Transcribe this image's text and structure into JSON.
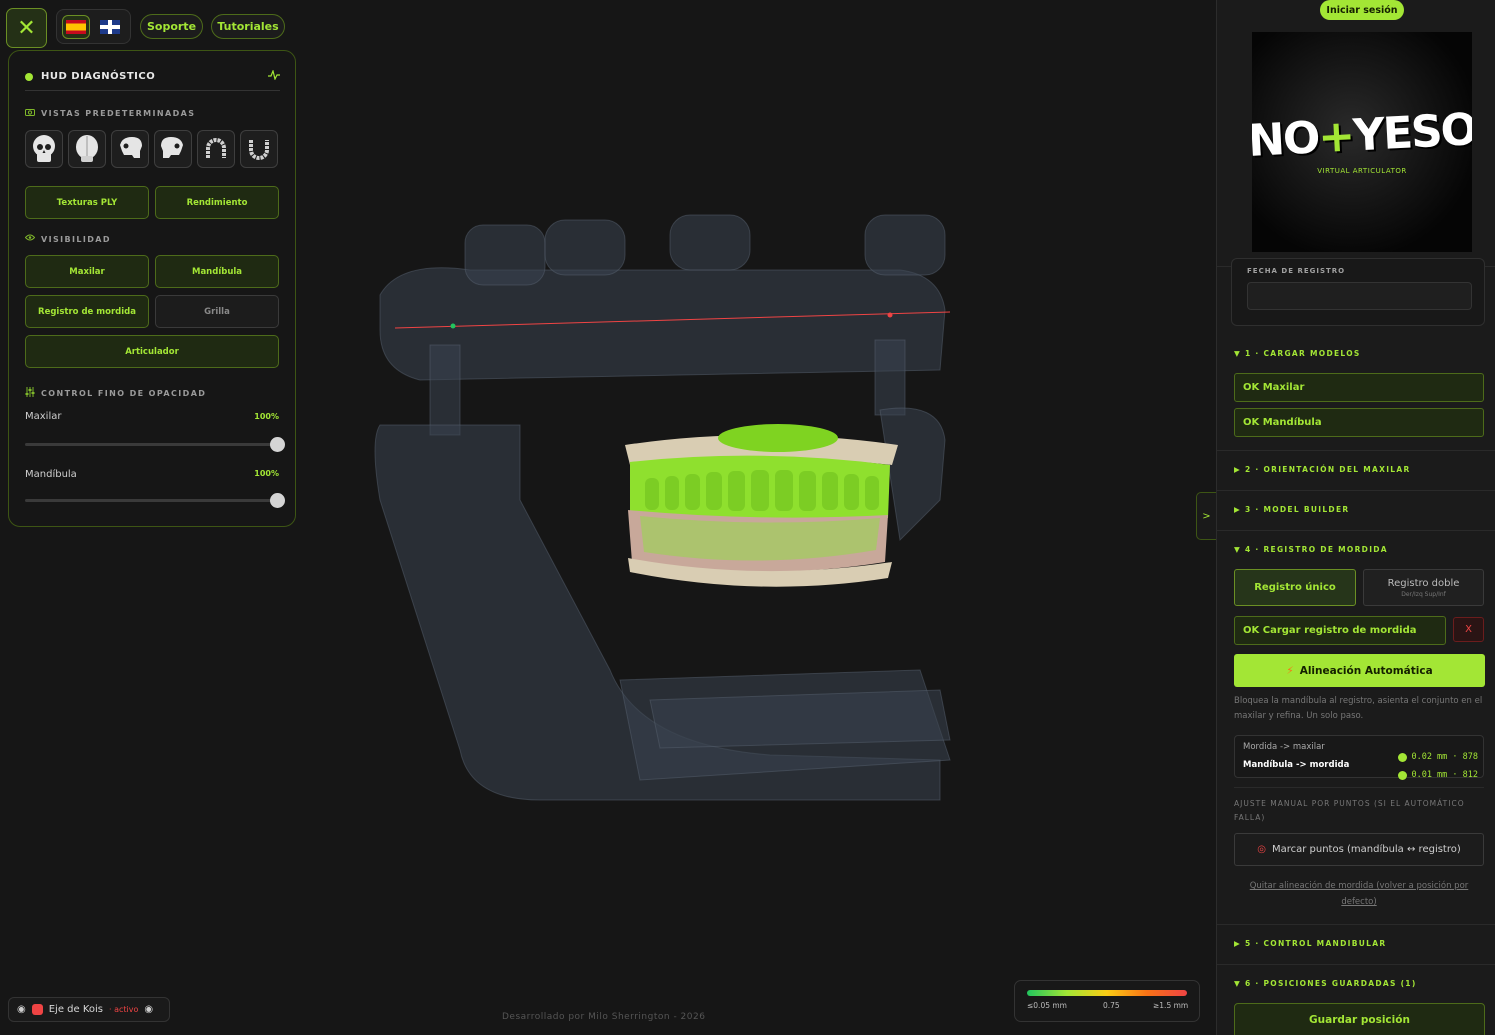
{
  "toolbar": {
    "close_symbol": "✕",
    "support": "Soporte",
    "tutorials": "Tutoriales"
  },
  "hud": {
    "title": "HUD DIAGNÓSTICO",
    "views_title": "VISTAS PREDETERMINADAS",
    "btn_textures": "Texturas PLY",
    "btn_performance": "Rendimiento",
    "visibility_title": "VISIBILIDAD",
    "vis": {
      "maxilar": "Maxilar",
      "mandibula": "Mandíbula",
      "registro": "Registro de mordida",
      "grilla": "Grilla",
      "articulador": "Articulador"
    },
    "opacity_title": "CONTROL FINO DE OPACIDAD",
    "opacity": [
      {
        "label": "Maxilar",
        "value": "100%",
        "level": 1.0
      },
      {
        "label": "Mandíbula",
        "value": "100%",
        "level": 1.0
      }
    ]
  },
  "footer": {
    "credit": "Desarrollado por Milo Sherrington - 2026"
  },
  "kois": {
    "label": "Eje de Kois",
    "status": "· activo"
  },
  "legend": {
    "min": "≤0.05 mm",
    "mid": "0.75",
    "max": "≥1.5 mm"
  },
  "side_toggle": ">",
  "panel": {
    "login": "Iniciar sesión",
    "logo": {
      "text_left": "NO",
      "text_plus": "+",
      "text_right": "YESO",
      "subtitle": "VIRTUAL ARTICULATOR"
    },
    "date_label": "FECHA DE REGISTRO",
    "sections": {
      "s1": "▼ 1 · CARGAR MODELOS",
      "s2": "▶ 2 · ORIENTACIÓN DEL MAXILAR",
      "s3": "▶ 3 · MODEL BUILDER",
      "s4": "▼ 4 · REGISTRO DE MORDIDA",
      "s5": "▶ 5 · CONTROL MANDIBULAR",
      "s6": "▼ 6 · POSICIONES GUARDADAS (1)"
    },
    "ok_maxilar": "OK Maxilar",
    "ok_mandibula": "OK Mandíbula",
    "reg_single": "Registro único",
    "reg_double": "Registro doble",
    "reg_double_sub": "Der/Izq Sup/Inf",
    "ok_load_bite": "OK Cargar registro de mordida",
    "remove": "X",
    "auto_align": "Alineación Automática",
    "auto_desc": "Bloquea la mandíbula al registro, asienta el conjunto en el maxilar y refina. Un solo paso.",
    "metrics": [
      {
        "label": "Mordida -> maxilar",
        "value": "0.02 mm · 878"
      },
      {
        "label": "Mandíbula -> mordida",
        "value": "0.01 mm · 812"
      }
    ],
    "manual_title": "AJUSTE MANUAL POR PUNTOS (SI EL AUTOMÁTICO FALLA)",
    "mark_points": "Marcar puntos (mandíbula ↔ registro)",
    "undo_align": "Quitar alineación de mordida (volver a posición por defecto)",
    "save_pos": "Guardar posición"
  },
  "colors": {
    "accent": "#a3e635",
    "danger": "#ef4444",
    "background": "#161616"
  },
  "icons": [
    "close-icon",
    "flag-es-icon",
    "flag-uk-icon",
    "pulse-icon",
    "camera-icon",
    "skull-icon",
    "eye-icon",
    "sliders-icon",
    "bolt-icon",
    "target-icon"
  ]
}
